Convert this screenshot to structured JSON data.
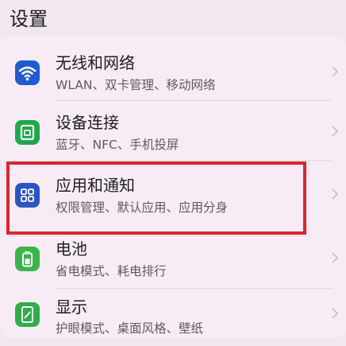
{
  "header": {
    "title": "设置"
  },
  "settings": {
    "items": [
      {
        "label": "无线和网络",
        "desc": "WLAN、双卡管理、移动网络",
        "icon": "wifi-icon",
        "color": "#1e5bd6"
      },
      {
        "label": "设备连接",
        "desc": "蓝牙、NFC、手机投屏",
        "icon": "device-connect-icon",
        "color": "#1ea84a"
      },
      {
        "label": "应用和通知",
        "desc": "权限管理、默认应用、应用分身",
        "icon": "apps-grid-icon",
        "color": "#2a55c8"
      },
      {
        "label": "电池",
        "desc": "省电模式、耗电排行",
        "icon": "battery-icon",
        "color": "#3ab54a"
      },
      {
        "label": "显示",
        "desc": "护眼模式、桌面风格、壁纸",
        "icon": "display-icon",
        "color": "#2fae48"
      }
    ]
  },
  "colors": {
    "highlight": "#e41f2c",
    "background": "#f2e6f0"
  }
}
